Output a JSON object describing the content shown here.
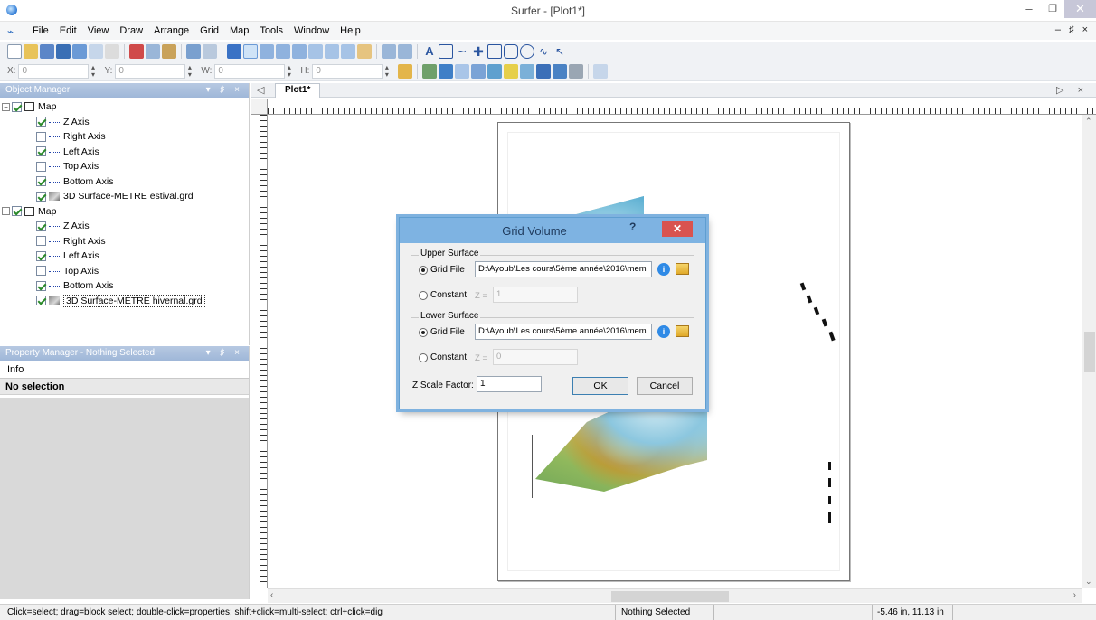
{
  "window": {
    "title": "Surfer - [Plot1*]",
    "minimize": "–",
    "maximize": "❐",
    "close": "✕"
  },
  "menu": {
    "items": [
      "File",
      "Edit",
      "View",
      "Draw",
      "Arrange",
      "Grid",
      "Map",
      "Tools",
      "Window",
      "Help"
    ],
    "mdi_controls": "– ♯ ×"
  },
  "coord_toolbar": {
    "x_label": "X:",
    "x_value": "0",
    "y_label": "Y:",
    "y_value": "0",
    "w_label": "W:",
    "w_value": "0",
    "h_label": "H:",
    "h_value": "0"
  },
  "object_manager": {
    "title": "Object Manager",
    "controls": "▾ ♯ ×",
    "maps": [
      {
        "label": "Map",
        "checked": true,
        "children": [
          {
            "label": "Z Axis",
            "checked": true,
            "icon": "axis-icon"
          },
          {
            "label": "Right Axis",
            "checked": false,
            "icon": "axis-icon"
          },
          {
            "label": "Left Axis",
            "checked": true,
            "icon": "axis-icon"
          },
          {
            "label": "Top Axis",
            "checked": false,
            "icon": "axis-icon"
          },
          {
            "label": "Bottom Axis",
            "checked": true,
            "icon": "axis-icon"
          },
          {
            "label": "3D Surface-METRE estival.grd",
            "checked": true,
            "icon": "surface-icon"
          }
        ]
      },
      {
        "label": "Map",
        "checked": true,
        "children": [
          {
            "label": "Z Axis",
            "checked": true,
            "icon": "axis-icon"
          },
          {
            "label": "Right Axis",
            "checked": false,
            "icon": "axis-icon"
          },
          {
            "label": "Left Axis",
            "checked": true,
            "icon": "axis-icon"
          },
          {
            "label": "Top Axis",
            "checked": false,
            "icon": "axis-icon"
          },
          {
            "label": "Bottom Axis",
            "checked": true,
            "icon": "axis-icon"
          },
          {
            "label": "3D Surface-METRE hivernal.grd",
            "checked": true,
            "icon": "surface-icon",
            "selected": true
          }
        ]
      }
    ]
  },
  "property_manager": {
    "title": "Property Manager - Nothing Selected",
    "controls": "▾ ♯ ×",
    "tab": "Info",
    "status": "No selection"
  },
  "document": {
    "tab": "Plot1*",
    "nav_left": "◁",
    "nav_right": "▷ ×"
  },
  "dialog": {
    "title": "Grid Volume",
    "help": "?",
    "close": "✕",
    "upper": {
      "group": "Upper Surface",
      "grid_file_label": "Grid File",
      "grid_file_selected": true,
      "path": "D:\\Ayoub\\Les cours\\5ème année\\2016\\mem",
      "constant_label": "Constant",
      "z_label": "Z =",
      "z_value": "1"
    },
    "lower": {
      "group": "Lower Surface",
      "grid_file_label": "Grid File",
      "grid_file_selected": true,
      "path": "D:\\Ayoub\\Les cours\\5ème année\\2016\\mem",
      "constant_label": "Constant",
      "z_label": "Z =",
      "z_value": "0"
    },
    "scale_label": "Z Scale Factor:",
    "scale_value": "1",
    "ok": "OK",
    "cancel": "Cancel"
  },
  "statusbar": {
    "hint": "Click=select; drag=block select; double-click=properties; shift+click=multi-select; ctrl+click=dig",
    "selection": "Nothing Selected",
    "coords": "-5.46 in, 11.13 in"
  }
}
